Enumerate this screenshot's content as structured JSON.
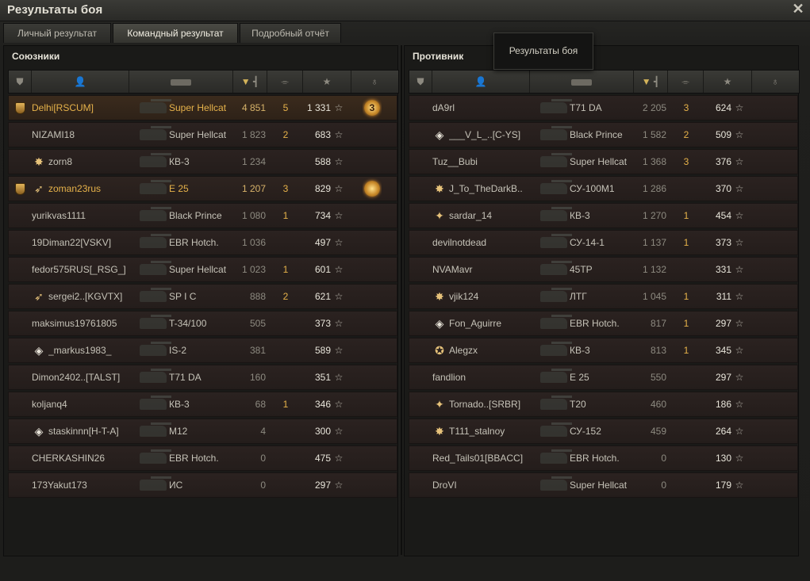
{
  "window": {
    "title": "Результаты боя",
    "close_icon": "close-icon"
  },
  "tabs": [
    {
      "label": "Личный результат"
    },
    {
      "label": "Командный результат",
      "active": true
    },
    {
      "label": "Подробный отчёт"
    }
  ],
  "tooltip": {
    "text": "Результаты боя"
  },
  "columns": {
    "squad_icon": "squad-icon",
    "player_icon": "player-icon",
    "tank_icon": "tank-icon",
    "damage_icon": "damage-icon",
    "kills_icon": "kills-icon",
    "xp_icon": "star-icon",
    "medal_icon": "medal-icon",
    "sorted_indicator": "▼"
  },
  "allies": {
    "title": "Союзники",
    "rows": [
      {
        "name": "Delhi[RSCUM]",
        "tank": "Super Hellcat",
        "damage": "4 851",
        "kills": "5",
        "xp": "1 331",
        "squad": true,
        "medal": "3",
        "me": true
      },
      {
        "name": "NIZAMI18",
        "tank": "Super Hellcat",
        "damage": "1 823",
        "kills": "2",
        "xp": "683"
      },
      {
        "name": "zorn8",
        "tank": "КВ-3",
        "damage": "1 234",
        "kills": "",
        "xp": "588",
        "emblem": "✸"
      },
      {
        "name": "zoman23rus",
        "tank": "E 25",
        "damage": "1 207",
        "kills": "3",
        "xp": "829",
        "squad": true,
        "emblem": "➶",
        "medal": "",
        "platoon": true
      },
      {
        "name": "yurikvas1111",
        "tank": "Black Prince",
        "damage": "1 080",
        "kills": "1",
        "xp": "734"
      },
      {
        "name": "19Diman22[VSKV]",
        "tank": "EBR Hotch.",
        "damage": "1 036",
        "kills": "",
        "xp": "497"
      },
      {
        "name": "fedor575RUS[_RSG_]",
        "tank": "Super Hellcat",
        "damage": "1 023",
        "kills": "1",
        "xp": "601"
      },
      {
        "name": "sergei2..[KGVTX]",
        "tank": "SP I C",
        "damage": "888",
        "kills": "2",
        "xp": "621",
        "emblem": "➶"
      },
      {
        "name": "maksimus19761805",
        "tank": "T-34/100",
        "damage": "505",
        "kills": "",
        "xp": "373"
      },
      {
        "name": "_markus1983_",
        "tank": "IS-2",
        "damage": "381",
        "kills": "",
        "xp": "589",
        "emblem": "◈"
      },
      {
        "name": "Dimon2402..[TALST]",
        "tank": "T71 DA",
        "damage": "160",
        "kills": "",
        "xp": "351"
      },
      {
        "name": "koljanq4",
        "tank": "КВ-3",
        "damage": "68",
        "kills": "1",
        "xp": "346"
      },
      {
        "name": "staskinnn[H-T-A]",
        "tank": "M12",
        "damage": "4",
        "kills": "",
        "xp": "300",
        "emblem": "◈"
      },
      {
        "name": "CHERKASHIN26",
        "tank": "EBR Hotch.",
        "damage": "0",
        "kills": "",
        "xp": "475"
      },
      {
        "name": "173Yakut173",
        "tank": "ИС",
        "damage": "0",
        "kills": "",
        "xp": "297"
      }
    ]
  },
  "enemies": {
    "title": "Противник",
    "rows": [
      {
        "name": "dA9rl",
        "tank": "T71 DA",
        "damage": "2 205",
        "kills": "3",
        "xp": "624"
      },
      {
        "name": "___V_L_..[C-YS]",
        "tank": "Black Prince",
        "damage": "1 582",
        "kills": "2",
        "xp": "509",
        "emblem": "◈"
      },
      {
        "name": "Tuz__Bubi",
        "tank": "Super Hellcat",
        "damage": "1 368",
        "kills": "3",
        "xp": "376"
      },
      {
        "name": "J_To_TheDarkB..",
        "tank": "СУ-100М1",
        "damage": "1 286",
        "kills": "",
        "xp": "370",
        "emblem": "✸"
      },
      {
        "name": "sardar_14",
        "tank": "КВ-3",
        "damage": "1 270",
        "kills": "1",
        "xp": "454",
        "emblem": "✦"
      },
      {
        "name": "devilnotdead",
        "tank": "СУ-14-1",
        "damage": "1 137",
        "kills": "1",
        "xp": "373"
      },
      {
        "name": "NVAMavr",
        "tank": "45TP",
        "damage": "1 132",
        "kills": "",
        "xp": "331"
      },
      {
        "name": "vjik124",
        "tank": "ЛТГ",
        "damage": "1 045",
        "kills": "1",
        "xp": "311",
        "emblem": "✸"
      },
      {
        "name": "Fon_Aguirre",
        "tank": "EBR Hotch.",
        "damage": "817",
        "kills": "1",
        "xp": "297",
        "emblem": "◈"
      },
      {
        "name": "Alegzx",
        "tank": "КВ-3",
        "damage": "813",
        "kills": "1",
        "xp": "345",
        "emblem": "✪"
      },
      {
        "name": "fandlion",
        "tank": "E 25",
        "damage": "550",
        "kills": "",
        "xp": "297"
      },
      {
        "name": "Tornado..[SRBR]",
        "tank": "T20",
        "damage": "460",
        "kills": "",
        "xp": "186",
        "emblem": "✦"
      },
      {
        "name": "T111_stalnoy",
        "tank": "СУ-152",
        "damage": "459",
        "kills": "",
        "xp": "264",
        "emblem": "✸"
      },
      {
        "name": "Red_Tails01[BBACC]",
        "tank": "EBR Hotch.",
        "damage": "0",
        "kills": "",
        "xp": "130"
      },
      {
        "name": "DroVI",
        "tank": "Super Hellcat",
        "damage": "0",
        "kills": "",
        "xp": "179"
      }
    ]
  },
  "colors": {
    "gold": "#e6b24a",
    "row_bg": "#2b2220",
    "panel_bg": "#1a1a18",
    "title_text": "#e4e1d6"
  }
}
